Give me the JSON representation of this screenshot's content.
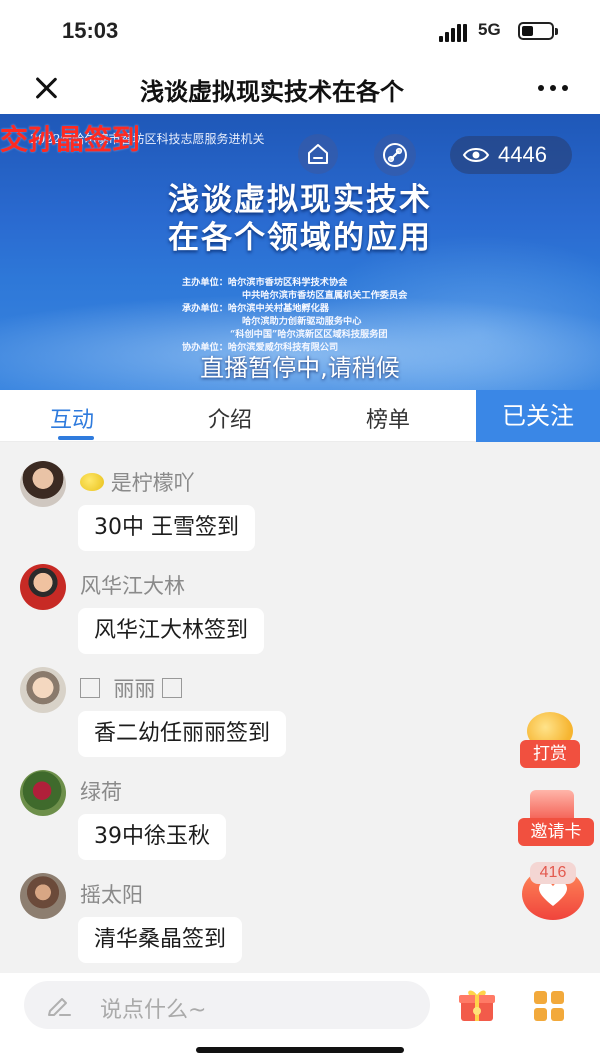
{
  "status_bar": {
    "time": "15:03",
    "network": "5G",
    "battery_level": 0.4
  },
  "header": {
    "title": "浅谈虚拟现实技术在各个",
    "close_icon": "close-icon",
    "more_icon": "more-dots-icon"
  },
  "video": {
    "watermark": "交孙晶签到",
    "event_line": "2022年哈尔滨市香坊区科技志愿服务进机关",
    "view_count": "4446",
    "title_line1": "浅谈虚拟现实技术",
    "title_line2": "在各个领域的应用",
    "credits": [
      "主办单位：哈尔滨市香坊区科学技术协会",
      "中共哈尔滨市香坊区直属机关工作委员会",
      "承办单位：哈尔滨中关村基地孵化器",
      "哈尔滨助力创新驱动服务中心",
      "“科创中国”哈尔滨新区区域科技服务团",
      "协办单位：哈尔滨爱威尔科技有限公司"
    ],
    "pause_text": "直播暂停中,请稍候"
  },
  "tabs": {
    "items": [
      "互动",
      "介绍",
      "榜单"
    ],
    "active_index": 0,
    "follow_label": "已关注"
  },
  "messages": [
    {
      "name": "是柠檬吖",
      "text": "30中 王雪签到"
    },
    {
      "name": "风华江大林",
      "text": "风华江大林签到"
    },
    {
      "name": "丽丽",
      "text": "香二幼任丽丽签到"
    },
    {
      "name": "绿荷",
      "text": "39中徐玉秋"
    },
    {
      "name": "摇太阳",
      "text": "清华桑晶签到"
    }
  ],
  "floating": {
    "reward_label": "打赏",
    "invite_label": "邀请卡",
    "like_count": "416"
  },
  "input": {
    "placeholder": "说点什么~"
  },
  "colors": {
    "accent_blue": "#2f7bdd",
    "follow_bg": "#3a87e6",
    "red": "#f1503f"
  }
}
